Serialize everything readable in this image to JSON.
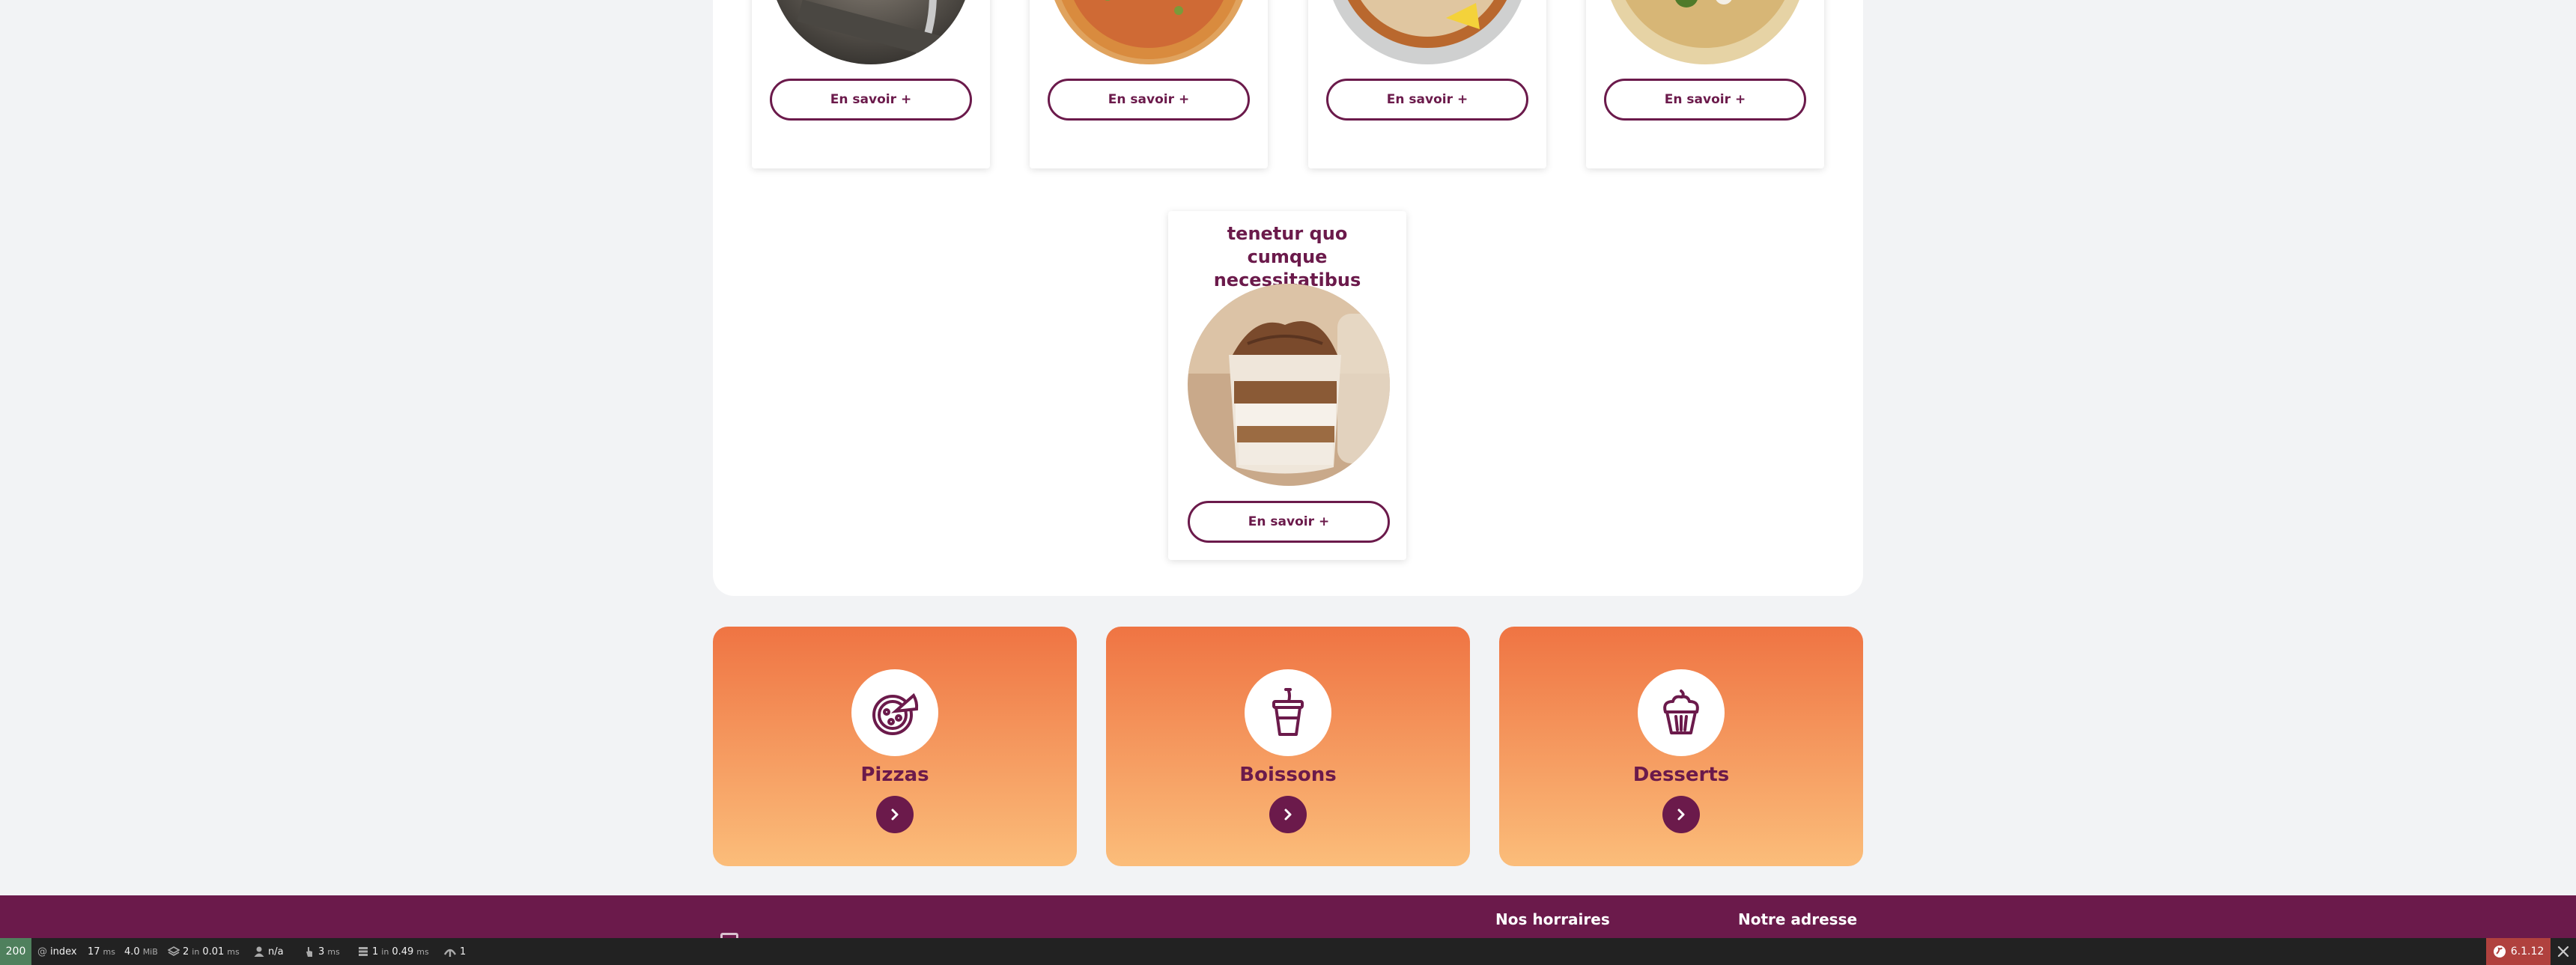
{
  "products": {
    "more_label": "En savoir",
    "plus_sign": "+",
    "featured_title": "tenetur quo cumque necessitatibus"
  },
  "categories": [
    {
      "label": "Pizzas",
      "icon": "pizza-icon"
    },
    {
      "label": "Boissons",
      "icon": "drink-icon"
    },
    {
      "label": "Desserts",
      "icon": "cupcake-icon"
    }
  ],
  "footer": {
    "hours_title": "Nos horraires",
    "address_title": "Notre adresse"
  },
  "debug_toolbar": {
    "status": "200",
    "route": "index",
    "time_value": "17",
    "time_unit": "ms",
    "memory_value": "4.0",
    "memory_unit": "MiB",
    "cache_count": "2",
    "cache_in": "in",
    "cache_time": "0.01",
    "cache_unit": "ms",
    "user": "n/a",
    "logger_value": "3",
    "logger_unit": "ms",
    "db_count": "1",
    "db_in": "in",
    "db_time": "0.49",
    "db_unit": "ms",
    "twig_count": "1",
    "version": "6.1.12"
  },
  "colors": {
    "brand": "#6b1a4b",
    "gradient_top": "#ef7443",
    "gradient_bottom": "#fbbd7a",
    "page_bg": "#f2f3f5",
    "toolbar_bg": "#222222",
    "status_ok": "#4f805d",
    "version_bg": "#b0413e"
  }
}
